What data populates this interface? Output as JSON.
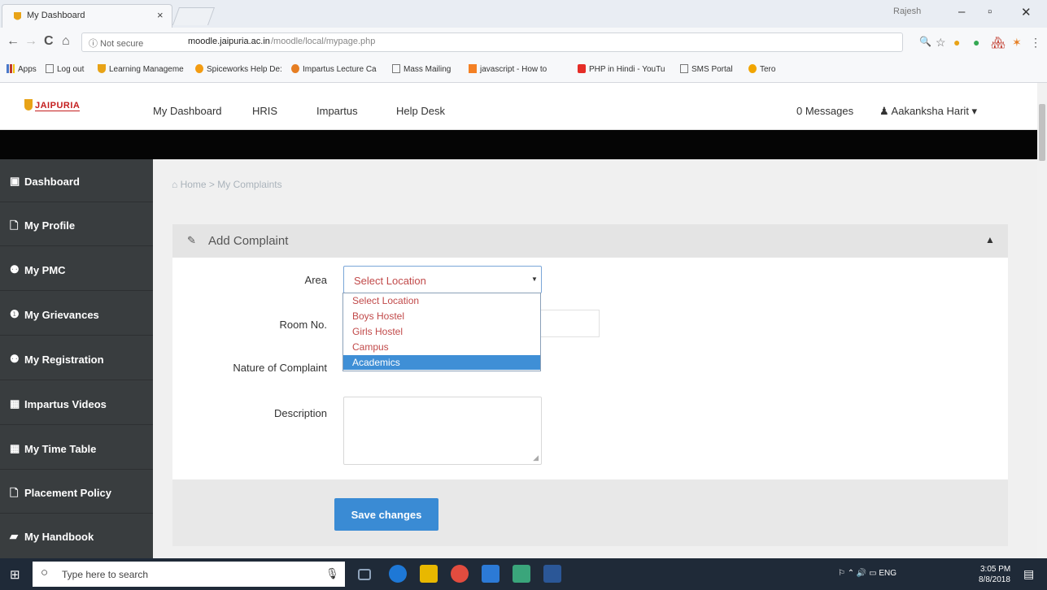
{
  "browser": {
    "tab_title": "My Dashboard",
    "tab_close": "×",
    "user_chip": "Rajesh",
    "window_controls": {
      "minimize": "–",
      "maximize": "▫",
      "close": "✕"
    },
    "nav": {
      "back": "←",
      "forward": "→",
      "reload": "C",
      "home": "⌂"
    },
    "security_label": "ⓘ Not secure",
    "url_host": "moodle.jaipuria.ac.in",
    "url_path": "/moodle/local/mypage.php",
    "extensions": [
      "🔍",
      "☆",
      "●",
      "●",
      "🏘",
      "✶",
      "⋮"
    ],
    "bookmarks": [
      {
        "label": "Apps",
        "icon": "apps-grid-icon",
        "color": "#4a78c8"
      },
      {
        "label": "Log out",
        "icon": "page-icon",
        "color": "#777777"
      },
      {
        "label": "Learning Manageme",
        "icon": "jaipuria-icon",
        "color": "#e8a317"
      },
      {
        "label": "Spiceworks Help De:",
        "icon": "spiceworks-icon",
        "color": "#f39c12"
      },
      {
        "label": "Impartus Lecture Ca",
        "icon": "impartus-icon",
        "color": "#e67e22"
      },
      {
        "label": "Mass Mailing",
        "icon": "page-icon",
        "color": "#777777"
      },
      {
        "label": "javascript - How to",
        "icon": "stackoverflow-icon",
        "color": "#f48024"
      },
      {
        "label": "PHP in Hindi - YouTu",
        "icon": "youtube-icon",
        "color": "#e52d27"
      },
      {
        "label": "SMS Portal",
        "icon": "page-icon",
        "color": "#777777"
      },
      {
        "label": "Tero",
        "icon": "tero-icon",
        "color": "#f1a500"
      }
    ]
  },
  "site": {
    "logo_text": "JAIPURIA",
    "nav": [
      "My Dashboard",
      "HRIS",
      "Impartus",
      "Help Desk"
    ],
    "messages": "0 Messages",
    "user": "♟ Aakanksha Harit ▾"
  },
  "sidebar": {
    "items": [
      {
        "label": "Dashboard",
        "icon": "dashboard-icon",
        "glyph": "▣"
      },
      {
        "label": "My Profile",
        "icon": "file-icon",
        "glyph": "🗋"
      },
      {
        "label": "My PMC",
        "icon": "group-icon",
        "glyph": "⚉"
      },
      {
        "label": "My Grievances",
        "icon": "alert-circle-icon",
        "glyph": "❶"
      },
      {
        "label": "My Registration",
        "icon": "group-icon",
        "glyph": "⚉"
      },
      {
        "label": "Impartus Videos",
        "icon": "calendar-icon",
        "glyph": "▦"
      },
      {
        "label": "My Time Table",
        "icon": "calendar-icon",
        "glyph": "▦"
      },
      {
        "label": "Placement Policy",
        "icon": "file-icon",
        "glyph": "🗋"
      },
      {
        "label": "My Handbook",
        "icon": "book-icon",
        "glyph": "▰"
      }
    ]
  },
  "breadcrumb": "⌂ Home > My Complaints",
  "form": {
    "edit_glyph": "✎",
    "collapse_glyph": "▲",
    "title": "Add Complaint",
    "area_label": "Area",
    "area_value": "Select Location",
    "area_caret": "▼",
    "room_label": "Room No.",
    "nature_label": "Nature of Complaint",
    "description_label": "Description",
    "resize_glyph": "◢",
    "options": [
      "Select Location",
      "Boys Hostel",
      "Girls Hostel",
      "Campus",
      "Academics"
    ],
    "selected_option": "Academics",
    "save": "Save changes"
  },
  "taskbar": {
    "start_glyph": "⊞",
    "search_glyph": "○",
    "search_placeholder": "Type here to search",
    "mic_glyph": "🎙",
    "apps": [
      {
        "name": "task-view",
        "color": "#2b3b50"
      },
      {
        "name": "edge",
        "color": "#1e78d6"
      },
      {
        "name": "store",
        "color": "#e8b800"
      },
      {
        "name": "chrome",
        "color": "#e24c3f"
      },
      {
        "name": "outlook",
        "color": "#2c7ad6"
      },
      {
        "name": "sticky",
        "color": "#3aa57b"
      },
      {
        "name": "word",
        "color": "#2b5797"
      }
    ],
    "tray": "⚐ ⌃ 🔊 ▭ ENG",
    "time": "3:05 PM",
    "date": "8/8/2018",
    "notification_glyph": "▤"
  },
  "colors": {
    "sidebar_bg": "#393d3f",
    "primary_button": "#3a8bd4",
    "option_text": "#c14a4a",
    "selected_option_bg": "#3f8fd6",
    "logo_red": "#c41e1e"
  }
}
